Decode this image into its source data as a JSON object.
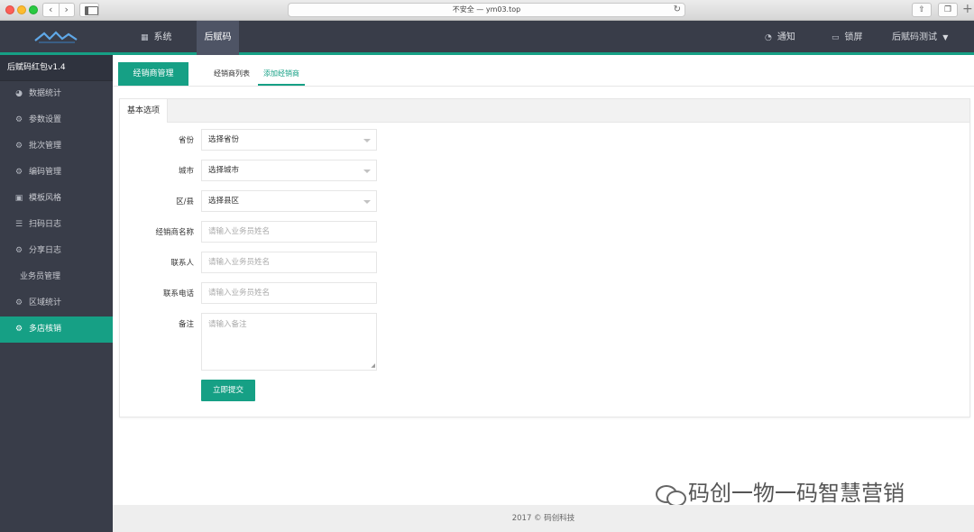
{
  "browser": {
    "url_text": "不安全 — ym03.top"
  },
  "header": {
    "system_label": "系统",
    "code_label": "后赋码",
    "notice_label": "通知",
    "lock_label": "锁屏",
    "user_label": "后赋码测试"
  },
  "sidebar": {
    "title": "后赋码红包v1.4",
    "items": [
      {
        "label": "数据统计",
        "icon": "pie-chart-icon"
      },
      {
        "label": "参数设置",
        "icon": "gear-icon"
      },
      {
        "label": "批次管理",
        "icon": "gear-icon"
      },
      {
        "label": "编码管理",
        "icon": "gear-icon"
      },
      {
        "label": "模板风格",
        "icon": "template-icon"
      },
      {
        "label": "扫码日志",
        "icon": "list-icon"
      },
      {
        "label": "分享日志",
        "icon": "gear-icon"
      },
      {
        "label": "业务员管理",
        "icon": ""
      },
      {
        "label": "区域统计",
        "icon": "gear-icon"
      },
      {
        "label": "多店核销",
        "icon": "gear-icon",
        "active": true
      }
    ]
  },
  "tabs": {
    "manage_label": "经销商管理",
    "list_label": "经销商列表",
    "add_label": "添加经销商"
  },
  "form": {
    "section_tab": "基本选项",
    "province": {
      "label": "省份",
      "value": "选择省份"
    },
    "city": {
      "label": "城市",
      "value": "选择城市"
    },
    "district": {
      "label": "区/县",
      "value": "选择县区"
    },
    "dealer_name": {
      "label": "经销商名称",
      "placeholder": "请输入业务员姓名"
    },
    "contact": {
      "label": "联系人",
      "placeholder": "请输入业务员姓名"
    },
    "phone": {
      "label": "联系电话",
      "placeholder": "请输入业务员姓名"
    },
    "remark": {
      "label": "备注",
      "placeholder": "请输入备注"
    },
    "submit_label": "立即提交"
  },
  "watermark_text": "码创一物一码智慧营销",
  "footer_text": "2017 © 码创科技",
  "colors": {
    "accent": "#16a085",
    "topbar": "#393d49"
  }
}
